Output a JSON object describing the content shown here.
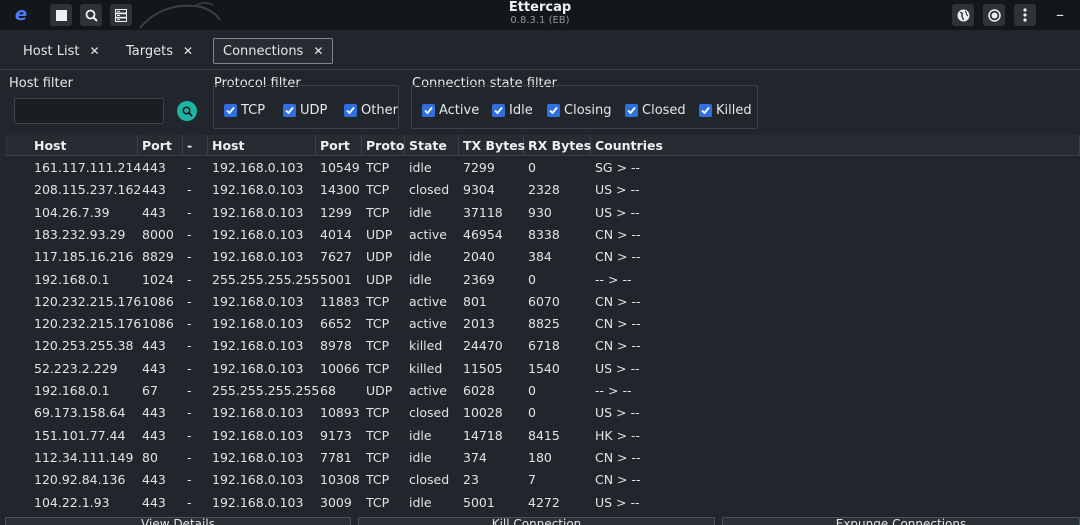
{
  "app": {
    "title": "Ettercap",
    "version": "0.8.3.1 (EB)"
  },
  "tabs": [
    {
      "label": "Host List",
      "close": "✕"
    },
    {
      "label": "Targets",
      "close": "✕"
    },
    {
      "label": "Connections",
      "close": "✕"
    }
  ],
  "filters": {
    "host_filter_label": "Host filter",
    "host_filter_value": "",
    "protocol_filter_label": "Protocol filter",
    "protocols": [
      "TCP",
      "UDP",
      "Other"
    ],
    "state_filter_label": "Connection state filter",
    "states": [
      "Active",
      "Idle",
      "Closing",
      "Closed",
      "Killed"
    ]
  },
  "table": {
    "columns": [
      "Host",
      "Port",
      "-",
      "Host",
      "Port",
      "Proto",
      "State",
      "TX Bytes",
      "RX Bytes",
      "Countries"
    ],
    "rows": [
      [
        "161.117.111.214",
        "443",
        "-",
        "192.168.0.103",
        "10549",
        "TCP",
        "idle",
        "7299",
        "0",
        "SG > --"
      ],
      [
        "208.115.237.162",
        "443",
        "-",
        "192.168.0.103",
        "14300",
        "TCP",
        "closed",
        "9304",
        "2328",
        "US > --"
      ],
      [
        "104.26.7.39",
        "443",
        "-",
        "192.168.0.103",
        "1299",
        "TCP",
        "idle",
        "37118",
        "930",
        "US > --"
      ],
      [
        "183.232.93.29",
        "8000",
        "-",
        "192.168.0.103",
        "4014",
        "UDP",
        "active",
        "46954",
        "8338",
        "CN > --"
      ],
      [
        "117.185.16.216",
        "8829",
        "-",
        "192.168.0.103",
        "7627",
        "UDP",
        "idle",
        "2040",
        "384",
        "CN > --"
      ],
      [
        "192.168.0.1",
        "1024",
        "-",
        "255.255.255.255",
        "5001",
        "UDP",
        "idle",
        "2369",
        "0",
        "-- > --"
      ],
      [
        "120.232.215.176",
        "1086",
        "-",
        "192.168.0.103",
        "11883",
        "TCP",
        "active",
        "801",
        "6070",
        "CN > --"
      ],
      [
        "120.232.215.176",
        "1086",
        "-",
        "192.168.0.103",
        "6652",
        "TCP",
        "active",
        "2013",
        "8825",
        "CN > --"
      ],
      [
        "120.253.255.38",
        "443",
        "-",
        "192.168.0.103",
        "8978",
        "TCP",
        "killed",
        "24470",
        "6718",
        "CN > --"
      ],
      [
        "52.223.2.229",
        "443",
        "-",
        "192.168.0.103",
        "10066",
        "TCP",
        "killed",
        "11505",
        "1540",
        "US > --"
      ],
      [
        "192.168.0.1",
        "67",
        "-",
        "255.255.255.255",
        "68",
        "UDP",
        "active",
        "6028",
        "0",
        "-- > --"
      ],
      [
        "69.173.158.64",
        "443",
        "-",
        "192.168.0.103",
        "10893",
        "TCP",
        "closed",
        "10028",
        "0",
        "US > --"
      ],
      [
        "151.101.77.44",
        "443",
        "-",
        "192.168.0.103",
        "9173",
        "TCP",
        "idle",
        "14718",
        "8415",
        "HK > --"
      ],
      [
        "112.34.111.149",
        "80",
        "-",
        "192.168.0.103",
        "7781",
        "TCP",
        "idle",
        "374",
        "180",
        "CN > --"
      ],
      [
        "120.92.84.136",
        "443",
        "-",
        "192.168.0.103",
        "10308",
        "TCP",
        "closed",
        "23",
        "7",
        "CN > --"
      ],
      [
        "104.22.1.93",
        "443",
        "-",
        "192.168.0.103",
        "3009",
        "TCP",
        "idle",
        "5001",
        "4272",
        "US > --"
      ]
    ]
  },
  "bottom_buttons": [
    "View Details",
    "Kill Connection",
    "Expunge Connections"
  ],
  "colors": {
    "background": "#20262b",
    "titlebar": "#14171a",
    "checkbox": "#2f6fe0",
    "search_button": "#1fb3a6"
  }
}
